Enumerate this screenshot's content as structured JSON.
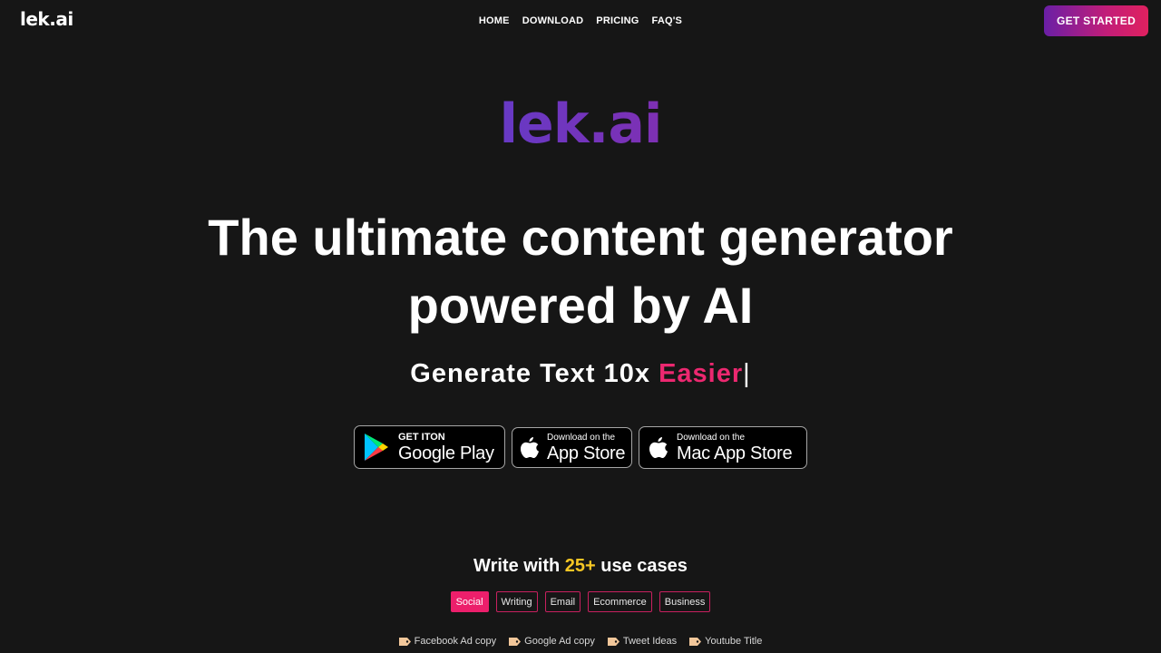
{
  "header": {
    "logo": "lek.ai",
    "nav": [
      {
        "label": "HOME"
      },
      {
        "label": "DOWNLOAD"
      },
      {
        "label": "PRICING"
      },
      {
        "label": "FAQ'S"
      }
    ],
    "cta_label": "GET STARTED"
  },
  "hero": {
    "logo": "lek.ai",
    "title_line1": "The ultimate content generator",
    "title_line2": "powered by AI",
    "subtitle_prefix": "Generate Text 10x ",
    "subtitle_accent": "Easier",
    "caret": "|"
  },
  "stores": {
    "google": {
      "small": "GET ITON",
      "big": "Google Play"
    },
    "appstore": {
      "small": "Download on the",
      "big": "App Store"
    },
    "macstore": {
      "small": "Download on the",
      "big": "Mac App Store"
    }
  },
  "usecases": {
    "title_prefix": "Write with ",
    "count": "25+",
    "title_suffix": " use cases",
    "categories": [
      {
        "label": "Social",
        "active": true
      },
      {
        "label": "Writing",
        "active": false
      },
      {
        "label": "Email",
        "active": false
      },
      {
        "label": "Ecommerce",
        "active": false
      },
      {
        "label": "Business",
        "active": false
      }
    ],
    "examples": [
      {
        "label": "Facebook Ad copy",
        "icon": "label-tag-icon"
      },
      {
        "label": "Google Ad copy",
        "icon": "label-tag-icon"
      },
      {
        "label": "Tweet Ideas",
        "icon": "label-tag-icon"
      },
      {
        "label": "Youtube Title",
        "icon": "label-tag-icon"
      }
    ]
  },
  "colors": {
    "background": "#161616",
    "accent_pink": "#ec1f6b",
    "accent_yellow": "#f6c624",
    "cta_gradient_start": "#6a1fa6",
    "cta_gradient_end": "#e0215f"
  }
}
